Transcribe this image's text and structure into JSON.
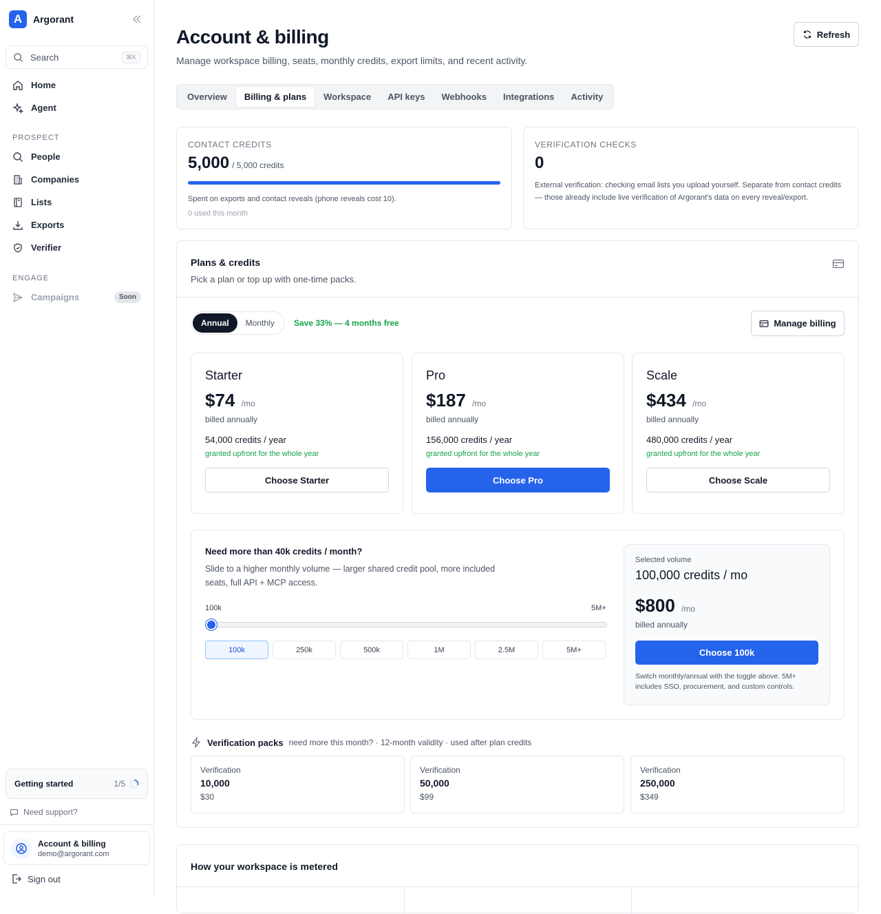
{
  "app": {
    "name": "Argorant",
    "logo_letter": "A"
  },
  "sidebar": {
    "search": {
      "label": "Search",
      "shortcut": "⌘K"
    },
    "top_items": [
      {
        "label": "Home",
        "icon": "home-icon"
      },
      {
        "label": "Agent",
        "icon": "sparkles-icon"
      }
    ],
    "prospect_label": "PROSPECT",
    "prospect_items": [
      {
        "label": "People",
        "icon": "search-icon"
      },
      {
        "label": "Companies",
        "icon": "building-icon"
      },
      {
        "label": "Lists",
        "icon": "book-icon"
      },
      {
        "label": "Exports",
        "icon": "download-icon"
      },
      {
        "label": "Verifier",
        "icon": "shield-check-icon"
      }
    ],
    "engage_label": "ENGAGE",
    "engage_items": [
      {
        "label": "Campaigns",
        "icon": "send-icon",
        "badge": "Soon"
      }
    ],
    "getting_started": {
      "label": "Getting started",
      "progress": "1/5"
    },
    "support": "Need support?",
    "account": {
      "name": "Account & billing",
      "email": "demo@argorant.com"
    },
    "sign_out": "Sign out"
  },
  "header": {
    "title": "Account & billing",
    "subtitle": "Manage workspace billing, seats, monthly credits, export limits, and recent activity.",
    "refresh": "Refresh"
  },
  "tabs": [
    {
      "label": "Overview",
      "active": false
    },
    {
      "label": "Billing & plans",
      "active": true
    },
    {
      "label": "Workspace",
      "active": false
    },
    {
      "label": "API keys",
      "active": false
    },
    {
      "label": "Webhooks",
      "active": false
    },
    {
      "label": "Integrations",
      "active": false
    },
    {
      "label": "Activity",
      "active": false
    }
  ],
  "contact_credits": {
    "label": "CONTACT CREDITS",
    "value": "5,000",
    "total": "/ 5,000 credits",
    "fill_fraction": 1.0,
    "description": "Spent on exports and contact reveals (phone reveals cost 10).",
    "used": "0 used this month"
  },
  "verification_checks": {
    "label": "VERIFICATION CHECKS",
    "value": "0",
    "description": "External verification: checking email lists you upload yourself. Separate from contact credits — those already include live verification of Argorant's data on every reveal/export."
  },
  "plans": {
    "title": "Plans & credits",
    "subtitle": "Pick a plan or top up with one-time packs.",
    "billing_toggle": {
      "annual": "Annual",
      "monthly": "Monthly",
      "selected": "Annual"
    },
    "save_note": "Save 33% — 4 months free",
    "manage_billing": "Manage billing",
    "items": [
      {
        "name": "Starter",
        "price": "$74",
        "per": "/mo",
        "billed": "billed annually",
        "credits": "54,000 credits / year",
        "grant": "granted upfront for the whole year",
        "button": "Choose Starter",
        "primary": false
      },
      {
        "name": "Pro",
        "price": "$187",
        "per": "/mo",
        "billed": "billed annually",
        "credits": "156,000 credits / year",
        "grant": "granted upfront for the whole year",
        "button": "Choose Pro",
        "primary": true
      },
      {
        "name": "Scale",
        "price": "$434",
        "per": "/mo",
        "billed": "billed annually",
        "credits": "480,000 credits / year",
        "grant": "granted upfront for the whole year",
        "button": "Choose Scale",
        "primary": false
      }
    ]
  },
  "volume": {
    "heading": "Need more than 40k credits / month?",
    "description": "Slide to a higher monthly volume — larger shared credit pool, more included seats, full API + MCP access.",
    "range_min": "100k",
    "range_max": "5M+",
    "slider_fraction": 0.0,
    "options": [
      "100k",
      "250k",
      "500k",
      "1M",
      "2.5M",
      "5M+"
    ],
    "selected_option": "100k",
    "selected": {
      "label": "Selected volume",
      "value": "100,000 credits / mo",
      "price": "$800",
      "per": "/mo",
      "billed": "billed annually",
      "button": "Choose 100k",
      "note": "Switch monthly/annual with the toggle above. 5M+ includes SSO, procurement, and custom controls."
    }
  },
  "verification_packs": {
    "title": "Verification packs",
    "description": "need more this month? · 12-month validity · used after plan credits",
    "items": [
      {
        "label": "Verification",
        "amount": "10,000",
        "price": "$30"
      },
      {
        "label": "Verification",
        "amount": "50,000",
        "price": "$99"
      },
      {
        "label": "Verification",
        "amount": "250,000",
        "price": "$349"
      }
    ]
  },
  "metering": {
    "title": "How your workspace is metered"
  },
  "colors": {
    "accent": "#2563eb",
    "success": "#16a34a",
    "dark": "#111827",
    "border": "#e5e7eb"
  }
}
